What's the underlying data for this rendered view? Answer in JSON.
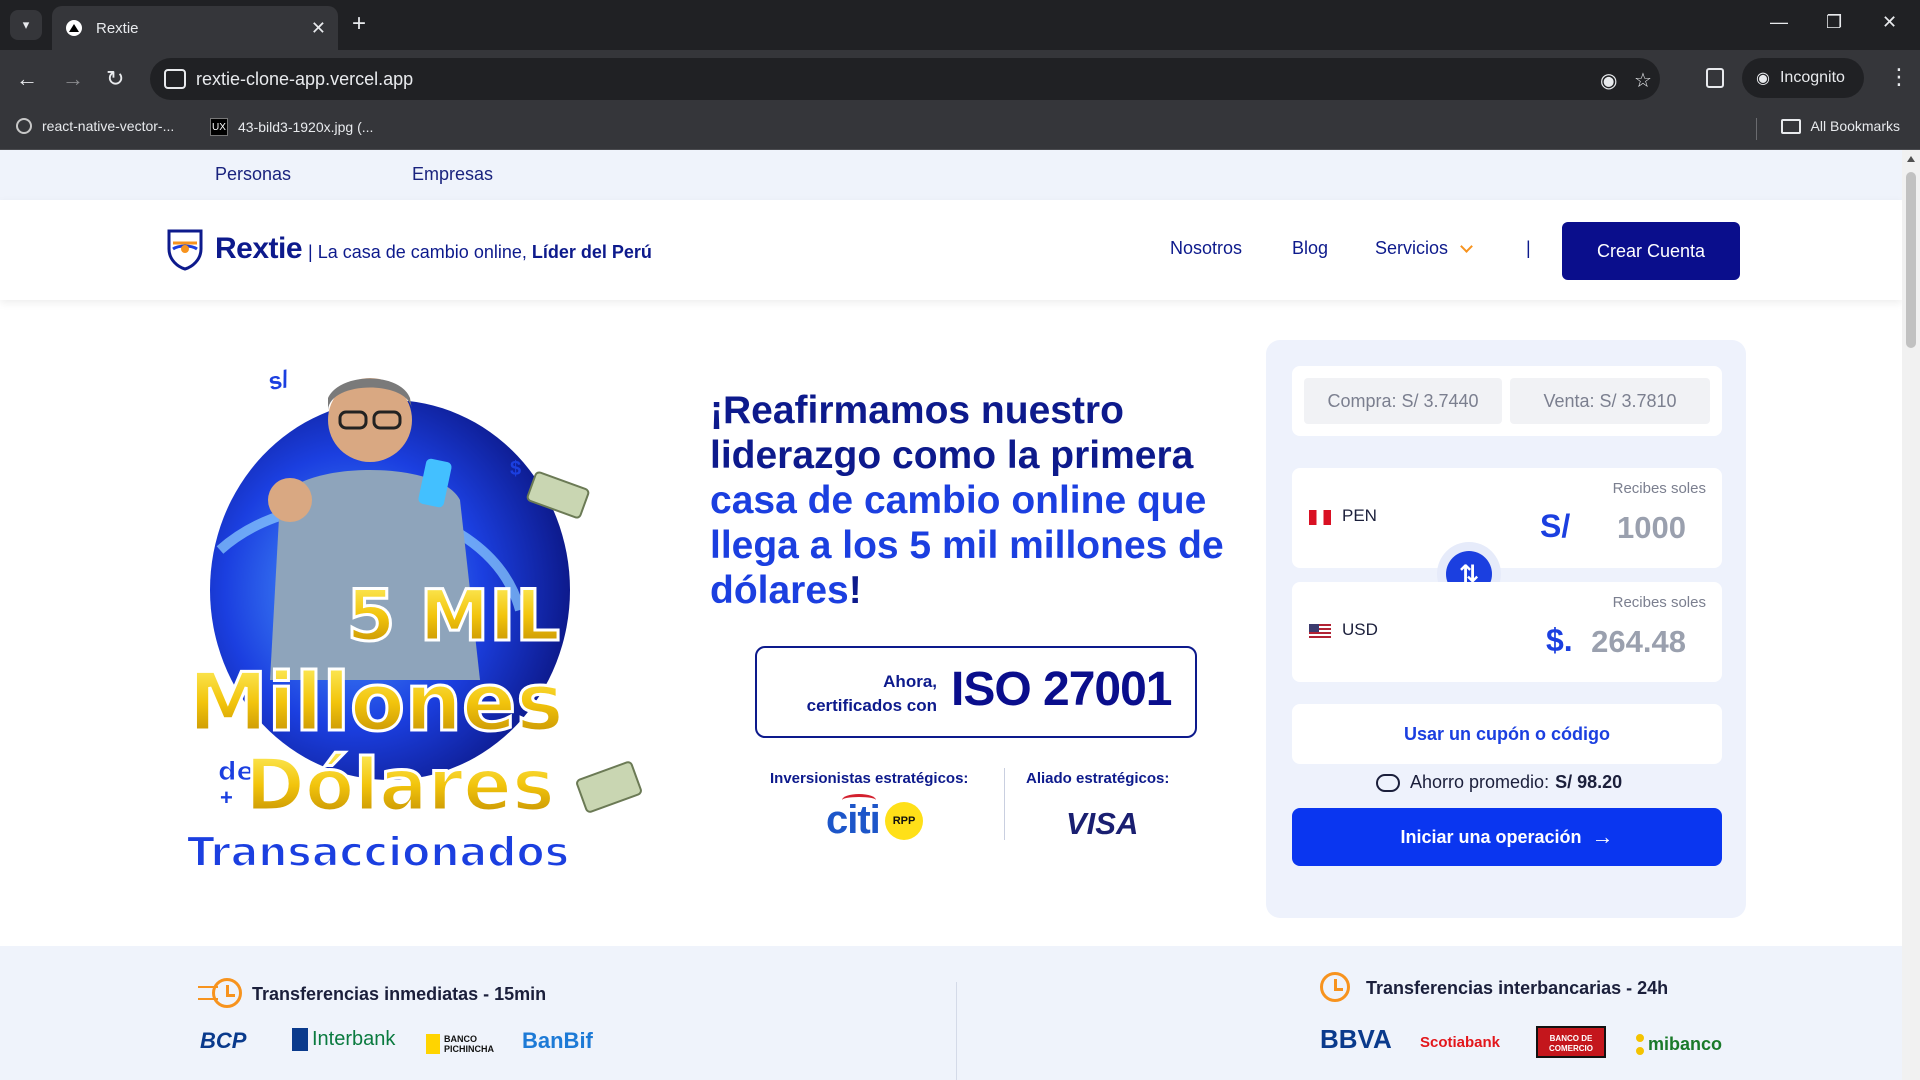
{
  "browser": {
    "tab_title": "Rextie",
    "url": "rextie-clone-app.vercel.app",
    "incognito_label": "Incognito",
    "bookmarks": [
      {
        "label": "react-native-vector-..."
      },
      {
        "label": "43-bild3-1920x.jpg (..."
      }
    ],
    "all_bookmarks_label": "All Bookmarks"
  },
  "segments": {
    "personas": "Personas",
    "empresas": "Empresas"
  },
  "header": {
    "brand": "Rextie",
    "tagline_prefix": "| La casa de cambio online, ",
    "tagline_bold": "Líder del Perú",
    "nav": {
      "nosotros": "Nosotros",
      "blog": "Blog",
      "servicios": "Servicios"
    },
    "separator": "|",
    "cta": "Crear Cuenta"
  },
  "hero": {
    "title_dark": "¡Reafirmamos nuestro liderazgo como la primera ",
    "title_blue": "casa de cambio online que llega a los 5 mil millones de dólares",
    "title_end": "!",
    "image_text": {
      "line1": "5 MIL",
      "line2": "Millones",
      "line3_small": "de",
      "line3": "Dólares",
      "line4": "Transaccionados",
      "sol": "s/"
    },
    "iso": {
      "small": "Ahora, certificados con",
      "big": "ISO 27001"
    },
    "investors_label": "Inversionistas estratégicos:",
    "allies_label": "Aliado estratégicos:",
    "citi": "citi",
    "rpp": "RPP",
    "visa": "VISA"
  },
  "calculator": {
    "buy_rate": "Compra: S/ 3.7440",
    "sell_rate": "Venta: S/ 3.7810",
    "from": {
      "code": "PEN",
      "recibes": "Recibes soles",
      "symbol": "S/",
      "value": "1000"
    },
    "to": {
      "code": "USD",
      "recibes": "Recibes soles",
      "symbol": "$.",
      "value": "264.48"
    },
    "coupon": "Usar un cupón o código",
    "savings_label": "Ahorro promedio:",
    "savings_value": "S/ 98.20",
    "start": "Iniciar una operación"
  },
  "band": {
    "immediate_title": "Transferencias inmediatas - 15min",
    "interbank_title": "Transferencias interbancarias - 24h",
    "immediate_banks": [
      "BCP",
      "Interbank",
      "BANCO PICHINCHA",
      "BanBif"
    ],
    "interbank_banks": [
      "BBVA",
      "Scotiabank",
      "BANCO DE COMERCIO",
      "mibanco"
    ]
  },
  "colors": {
    "brand_navy": "#0d1a8c",
    "brand_blue": "#1b3fe0",
    "accent_orange": "#f7931e",
    "cta_blue": "#0a36f0"
  }
}
